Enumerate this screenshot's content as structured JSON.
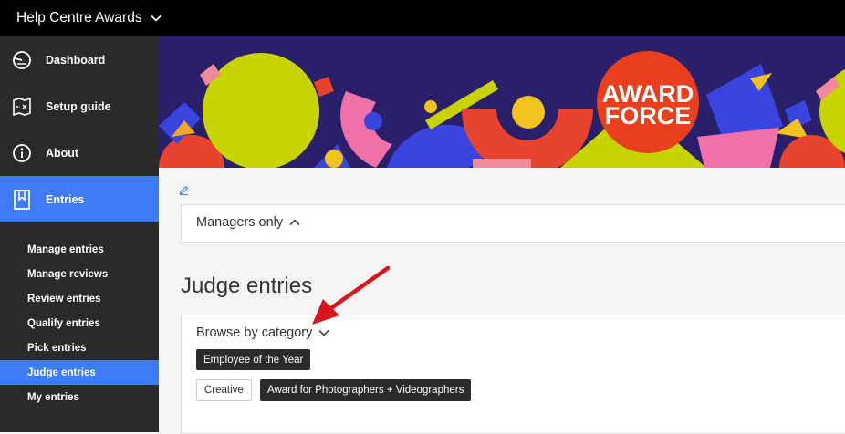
{
  "topbar": {
    "title": "Help Centre Awards"
  },
  "sidebar": {
    "items": [
      {
        "label": "Dashboard",
        "icon": "dashboard-icon"
      },
      {
        "label": "Setup guide",
        "icon": "setup-guide-icon"
      },
      {
        "label": "About",
        "icon": "info-icon"
      },
      {
        "label": "Entries",
        "icon": "bookmark-icon",
        "active": true
      }
    ],
    "subitems": [
      {
        "label": "Manage entries"
      },
      {
        "label": "Manage reviews"
      },
      {
        "label": "Review entries"
      },
      {
        "label": "Qualify entries"
      },
      {
        "label": "Pick entries"
      },
      {
        "label": "Judge entries",
        "active": true
      },
      {
        "label": "My entries"
      }
    ]
  },
  "banner": {
    "logo_line1": "AWARD",
    "logo_line2": "FORCE"
  },
  "main": {
    "managers_toggle": "Managers only",
    "section_title": "Judge entries",
    "browse_toggle": "Browse by category",
    "tags": {
      "employee": "Employee of the Year",
      "creative": "Creative",
      "photographers": "Award for Photographers + Videographers"
    }
  },
  "colors": {
    "accent": "#3d7cf6",
    "sidebar": "#2a2a2a",
    "topbar": "#000000",
    "annotation_arrow": "#d8141c"
  }
}
